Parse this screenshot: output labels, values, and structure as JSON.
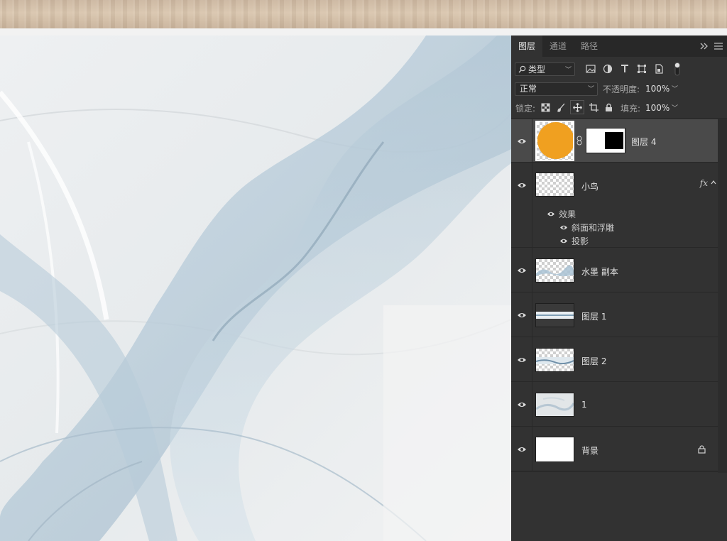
{
  "panel": {
    "tabs": [
      {
        "label": "图层"
      },
      {
        "label": "通道"
      },
      {
        "label": "路径"
      }
    ],
    "filter": {
      "label": "类型"
    },
    "blend_mode": "正常",
    "opacity": {
      "label": "不透明度:",
      "value": "100%"
    },
    "lock": {
      "label": "锁定:"
    },
    "fill": {
      "label": "填充:",
      "value": "100%"
    },
    "layers": [
      {
        "name": "图层 4",
        "selected": true,
        "thumb": "orange-circle",
        "has_mask": true
      },
      {
        "name": "小鸟",
        "thumb": "transparent",
        "fx": "fx",
        "effects": {
          "label": "效果",
          "items": [
            "斜面和浮雕",
            "投影"
          ]
        }
      },
      {
        "name": "水墨 副本",
        "thumb": "ink-wash"
      },
      {
        "name": "图层 1",
        "thumb": "thin-strip"
      },
      {
        "name": "图层 2",
        "thumb": "wave-strip"
      },
      {
        "name": "1",
        "thumb": "marble"
      },
      {
        "name": "背景",
        "thumb": "white",
        "locked": true
      }
    ]
  },
  "colors": {
    "panel_bg": "#323232",
    "selected_bg": "#4a4a4a",
    "thumb_orange": "#f0a020"
  }
}
